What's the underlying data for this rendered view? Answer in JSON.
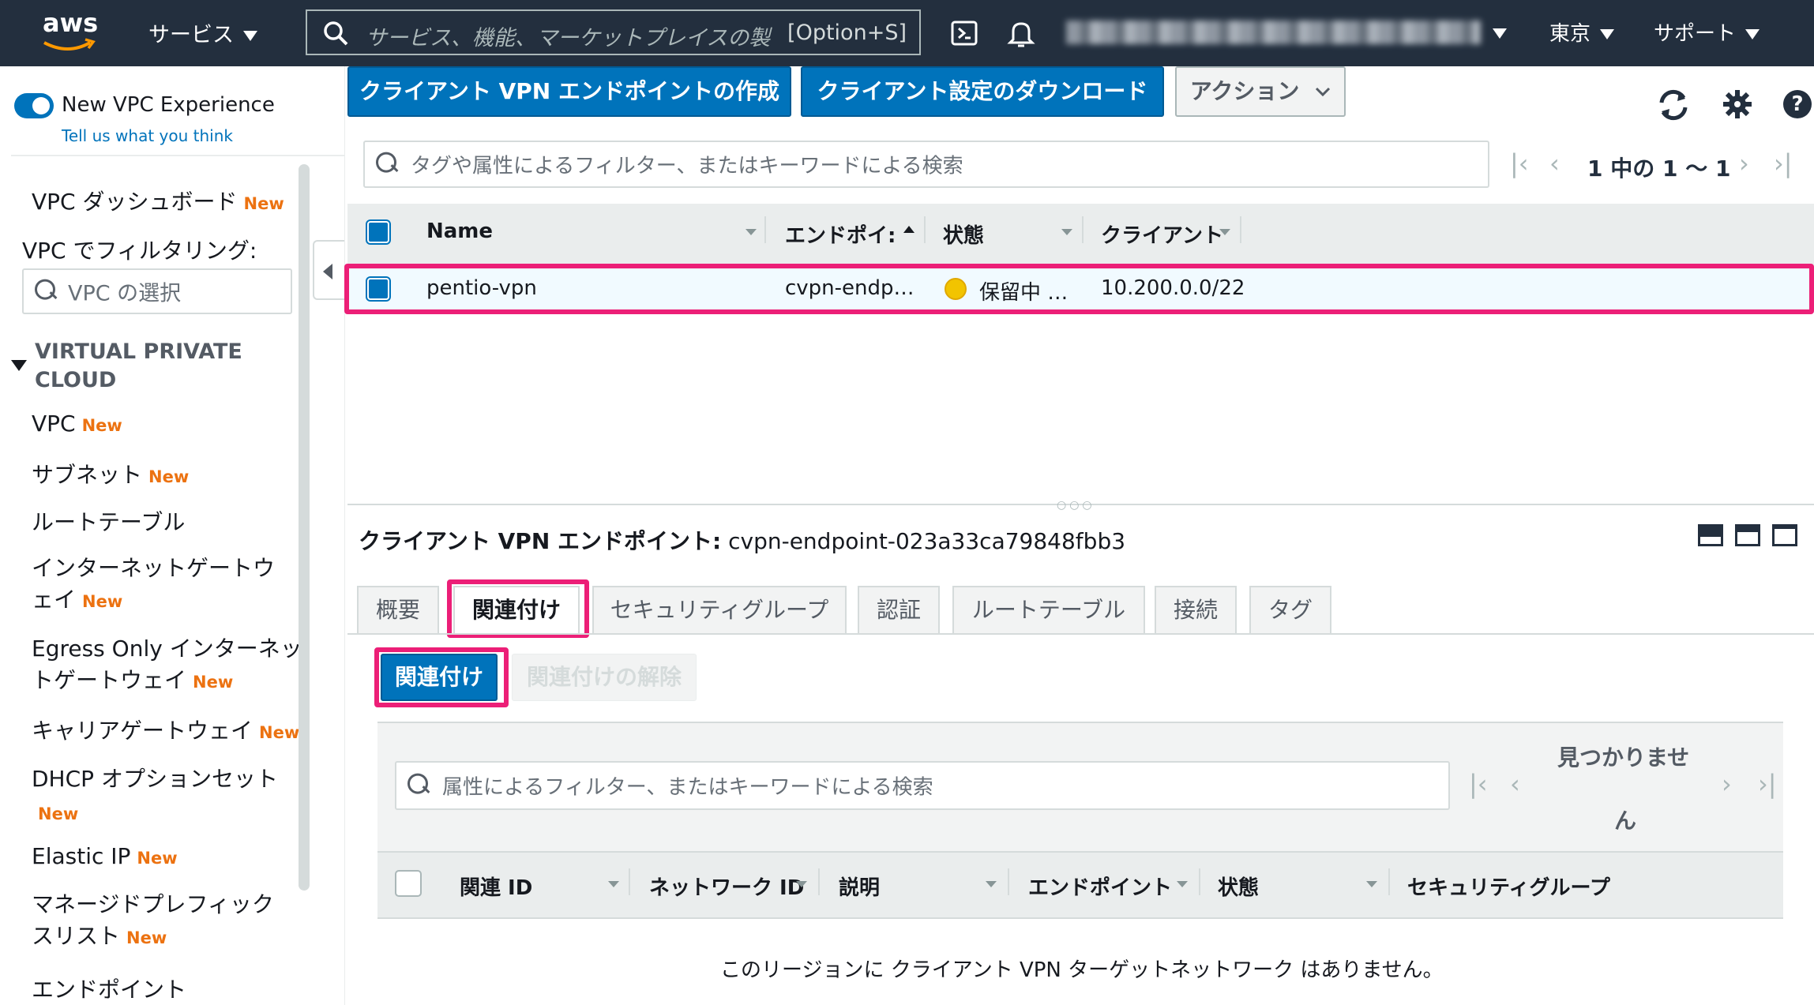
{
  "topnav": {
    "logo": "aws",
    "services_label": "サービス",
    "search_placeholder": "サービス、機能、マーケットプレイスの製",
    "search_shortcut": "[Option+S]",
    "region": "東京",
    "support": "サポート"
  },
  "sidebar": {
    "toggle_label": "New VPC Experience",
    "feedback_link": "Tell us what you think",
    "dashboard": "VPC ダッシュボード",
    "filter_label": "VPC でフィルタリング:",
    "filter_placeholder": "VPC の選択",
    "section_title_1": "VIRTUAL PRIVATE",
    "section_title_2": "CLOUD",
    "new_badge": "New",
    "items": [
      {
        "label": "VPC"
      },
      {
        "label": "サブネット"
      },
      {
        "label": "ルートテーブル"
      },
      {
        "line1": "インターネットゲートウ",
        "line2": "ェイ"
      },
      {
        "line1": "Egress Only インターネッ",
        "line2": "トゲートウェイ"
      },
      {
        "label": "キャリアゲートウェイ"
      },
      {
        "line1": "DHCP オプションセット"
      },
      {
        "label": "Elastic IP"
      },
      {
        "line1": "マネージドプレフィック",
        "line2": "スリスト"
      },
      {
        "label": "エンドポイント"
      }
    ]
  },
  "toolbar": {
    "create_button": "クライアント VPN エンドポイントの作成",
    "download_button": "クライアント設定のダウンロード",
    "actions_button": "アクション"
  },
  "main_filter_placeholder": "タグや属性によるフィルター、またはキーワードによる検索",
  "pagination": "1 中の 1 〜 1",
  "table": {
    "headers": [
      "Name",
      "エンドポイ:",
      "状態",
      "クライアント"
    ],
    "row": {
      "name": "pentio-vpn",
      "endpoint": "cvpn-endp…",
      "status": "保留中 …",
      "client": "10.200.0.0/22"
    }
  },
  "detail": {
    "title_label": "クライアント VPN エンドポイント:",
    "endpoint_id": "cvpn-endpoint-023a33ca79848fbb3",
    "tabs": [
      "概要",
      "関連付け",
      "セキュリティグループ",
      "認証",
      "ルートテーブル",
      "接続",
      "タグ"
    ],
    "associate_button": "関連付け",
    "disassociate_button": "関連付けの解除",
    "filter_placeholder": "属性によるフィルター、またはキーワードによる検索",
    "not_found_1": "見つかりませ",
    "not_found_2": "ん",
    "headers": [
      "関連 ID",
      "ネットワーク ID",
      "説明",
      "エンドポイント",
      "状態",
      "セキュリティグループ"
    ],
    "empty_message": "このリージョンに クライアント VPN ターゲットネットワーク はありません。"
  },
  "colors": {
    "nav_bg": "#232f3e",
    "primary": "#0073bb",
    "highlight": "#ec1f77",
    "new_badge": "#ec7211",
    "pending": "#f2c400"
  }
}
